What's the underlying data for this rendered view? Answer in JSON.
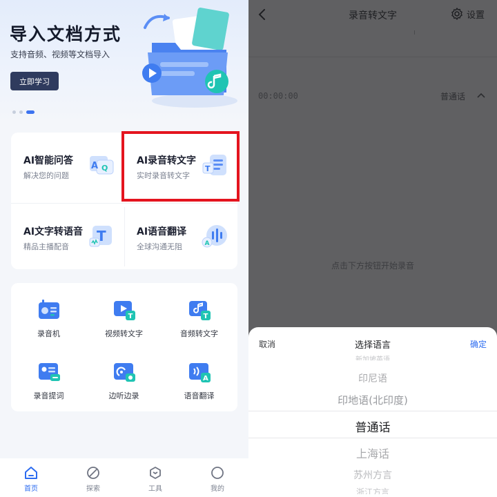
{
  "left": {
    "banner": {
      "title": "导入文档方式",
      "subtitle": "支持音频、视频等文档导入",
      "button_label": "立即学习",
      "dots": 3,
      "active_dot": 2
    },
    "features": [
      {
        "title": "AI智能问答",
        "subtitle": "解决您的问题",
        "icon": "qa-bubble-icon"
      },
      {
        "title": "AI录音转文字",
        "subtitle": "实时录音转文字",
        "icon": "recording-to-text-icon"
      },
      {
        "title": "AI文字转语音",
        "subtitle": "精品主播配音",
        "icon": "text-to-speech-icon"
      },
      {
        "title": "AI语音翻译",
        "subtitle": "全球沟通无阻",
        "icon": "voice-translate-icon"
      }
    ],
    "tools": [
      {
        "label": "录音机",
        "icon": "radio-recorder-icon"
      },
      {
        "label": "视频转文字",
        "icon": "video-to-text-icon"
      },
      {
        "label": "音频转文字",
        "icon": "audio-to-text-icon"
      },
      {
        "label": "录音提词",
        "icon": "teleprompter-icon"
      },
      {
        "label": "边听边录",
        "icon": "listen-record-icon"
      },
      {
        "label": "语音翻译",
        "icon": "speech-translate-icon"
      }
    ],
    "tabbar": [
      {
        "label": "首页",
        "icon": "home-icon",
        "active": true
      },
      {
        "label": "探索",
        "icon": "compass-icon",
        "active": false
      },
      {
        "label": "工具",
        "icon": "toolbox-icon",
        "active": false
      },
      {
        "label": "我的",
        "icon": "profile-icon",
        "active": false
      }
    ]
  },
  "right": {
    "header": {
      "title": "录音转文字",
      "settings_label": "设置"
    },
    "timer": "00:00:00",
    "language": "普通话",
    "hint": "点击下方按钮开始录音",
    "sheet": {
      "cancel_label": "取消",
      "title": "选择语言",
      "confirm_label": "确定",
      "options": [
        "新加坡英语",
        "印尼语",
        "印地语(北印度)",
        "普通话",
        "上海话",
        "苏州方言",
        "浙江方言"
      ],
      "selected": "普通话"
    }
  },
  "colors": {
    "accent": "#2d6cf0",
    "highlight_border": "#e4141e",
    "dark_button": "#2f3b5e",
    "overlay": "#606062"
  }
}
